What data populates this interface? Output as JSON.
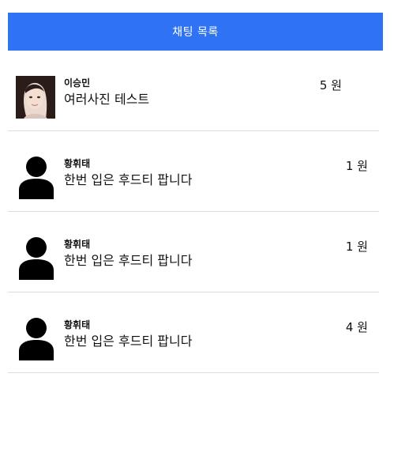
{
  "header": {
    "title": "채팅 목록"
  },
  "chats": [
    {
      "name": "이승민",
      "title": "여러사진 테스트",
      "price": "5 원",
      "avatar": "photo"
    },
    {
      "name": "황휘태",
      "title": "한번 입은 후드티 팝니다",
      "price": "1 원",
      "avatar": "default"
    },
    {
      "name": "황휘태",
      "title": "한번 입은 후드티 팝니다",
      "price": "1 원",
      "avatar": "default"
    },
    {
      "name": "황휘태",
      "title": "한번 입은 후드티 팝니다",
      "price": "4 원",
      "avatar": "default"
    }
  ],
  "colors": {
    "header_bg": "#2f73f4",
    "divider": "#dddddd"
  }
}
